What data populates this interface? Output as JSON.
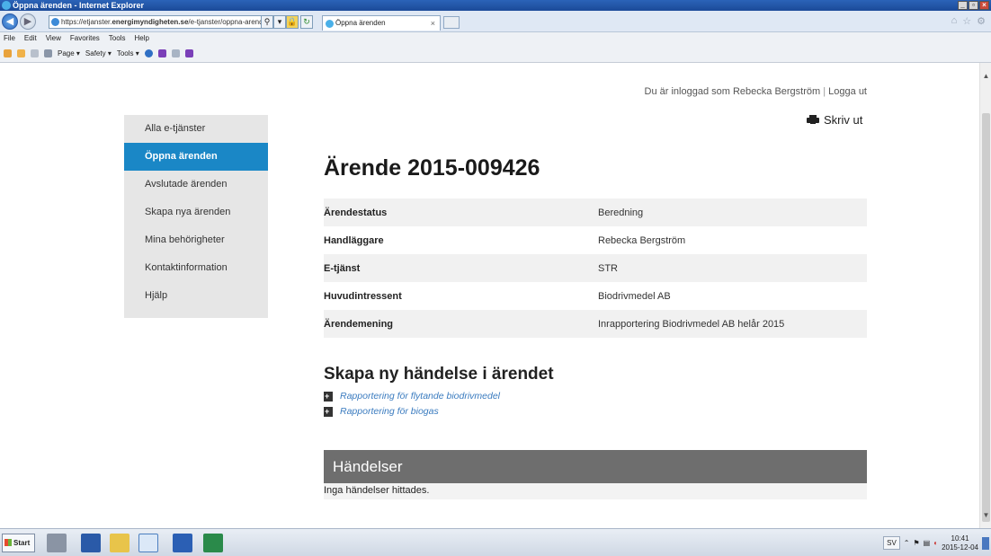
{
  "browser": {
    "window_title": "Öppna ärenden - Internet Explorer",
    "url_prefix": "https://etjanster.",
    "url_domain": "energimyndigheten.se",
    "url_path": "/e-tjanster/oppna-arenden",
    "tab_title": "Öppna ärenden",
    "menu": [
      "File",
      "Edit",
      "View",
      "Favorites",
      "Tools",
      "Help"
    ],
    "command_bar": [
      "Page ▾",
      "Safety ▾",
      "Tools ▾"
    ]
  },
  "header": {
    "logged_in_text": "Du är inloggad som Rebecka Bergström",
    "separator": "|",
    "logout_label": "Logga ut",
    "print_label": "Skriv ut"
  },
  "sidebar": {
    "items": [
      {
        "label": "Alla e-tjänster",
        "active": false
      },
      {
        "label": "Öppna ärenden",
        "active": true
      },
      {
        "label": "Avslutade ärenden",
        "active": false
      },
      {
        "label": "Skapa nya ärenden",
        "active": false
      },
      {
        "label": "Mina behörigheter",
        "active": false
      },
      {
        "label": "Kontaktinformation",
        "active": false
      },
      {
        "label": "Hjälp",
        "active": false
      }
    ]
  },
  "case": {
    "title": "Ärende 2015-009426",
    "rows": [
      {
        "key": "Ärendestatus",
        "value": "Beredning"
      },
      {
        "key": "Handläggare",
        "value": "Rebecka Bergström"
      },
      {
        "key": "E-tjänst",
        "value": "STR"
      },
      {
        "key": "Huvudintressent",
        "value": "Biodrivmedel AB"
      },
      {
        "key": "Ärendemening",
        "value": "Inrapportering Biodrivmedel AB helår 2015"
      }
    ]
  },
  "new_event": {
    "heading": "Skapa ny händelse i ärendet",
    "links": [
      "Rapportering för flytande biodrivmedel",
      "Rapportering för biogas"
    ]
  },
  "events": {
    "heading": "Händelser",
    "empty_text": "Inga händelser hittades."
  },
  "taskbar": {
    "start_label": "Start",
    "language": "SV",
    "time": "10:41",
    "date": "2015-12-04"
  },
  "colors": {
    "accent": "#1a87c6",
    "link": "#3a7bbf",
    "events_header": "#6e6e6e",
    "sidebar_bg": "#e6e6e6"
  }
}
